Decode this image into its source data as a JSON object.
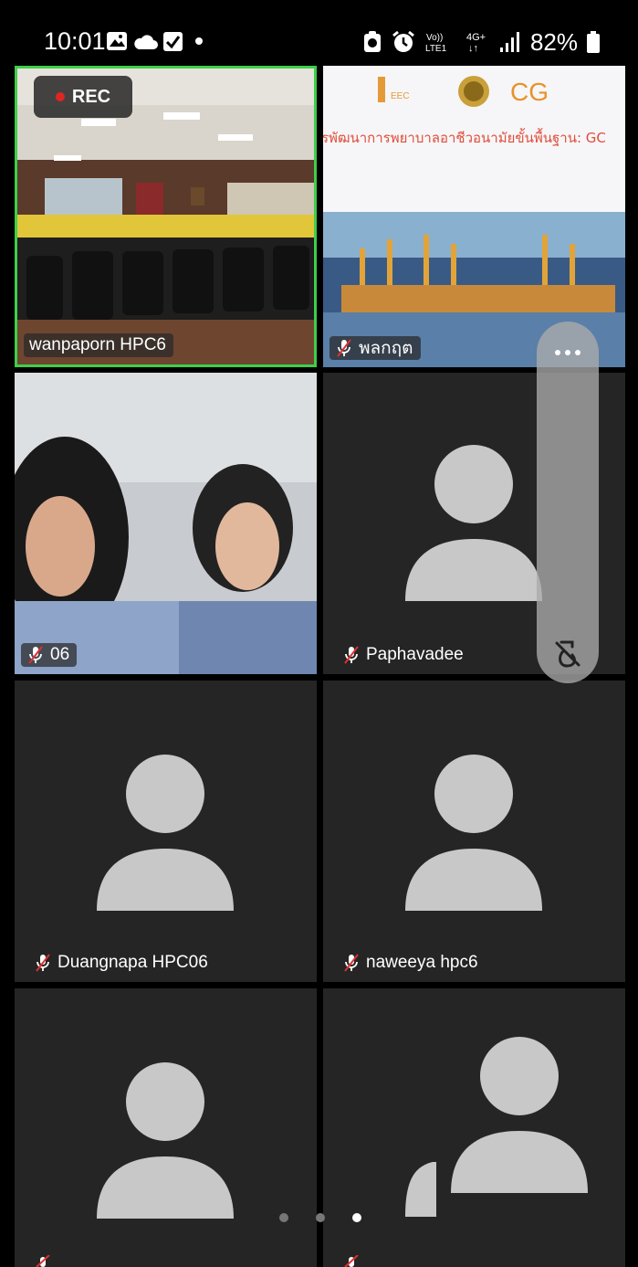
{
  "status_bar": {
    "time": "10:01",
    "battery": "82%",
    "network": "4G+",
    "volte": "Vo))\nLTE1",
    "icons": [
      "gallery-icon",
      "cloud-icon",
      "checkbox-icon",
      "dot-icon",
      "vpn-icon",
      "alarm-icon",
      "signal-icon",
      "battery-icon"
    ]
  },
  "recording": {
    "label": "REC"
  },
  "tiles": [
    {
      "name": "wanpaporn HPC6",
      "muted": false,
      "active": true,
      "content": "video-classroom"
    },
    {
      "name": "พลกฤต",
      "muted": true,
      "active": false,
      "content": "video-presentation"
    },
    {
      "name": "06",
      "muted": true,
      "active": false,
      "content": "video-people"
    },
    {
      "name": "Paphavadee",
      "muted": true,
      "active": false,
      "content": "avatar"
    },
    {
      "name": "Duangnapa HPC06",
      "muted": true,
      "active": false,
      "content": "avatar"
    },
    {
      "name": "naweeya hpc6",
      "muted": true,
      "active": false,
      "content": "avatar"
    },
    {
      "name": "",
      "muted": true,
      "active": false,
      "content": "avatar"
    },
    {
      "name": "",
      "muted": true,
      "active": false,
      "content": "avatar"
    }
  ],
  "presentation": {
    "slide_text": "รพัฒนาการพยาบาลอาชีวอนามัยขั้นพื้นฐาน: GC",
    "logo_eec": "EEC"
  },
  "floating_panel": {
    "icons": [
      "more-icon",
      "pip-off-icon"
    ]
  },
  "pagination": {
    "pages": 3,
    "current": 3
  },
  "colors": {
    "active_border": "#3ecf4a",
    "tile_bg": "#252525",
    "avatar": "#c8c8c8",
    "rec_dot": "#e02525"
  }
}
